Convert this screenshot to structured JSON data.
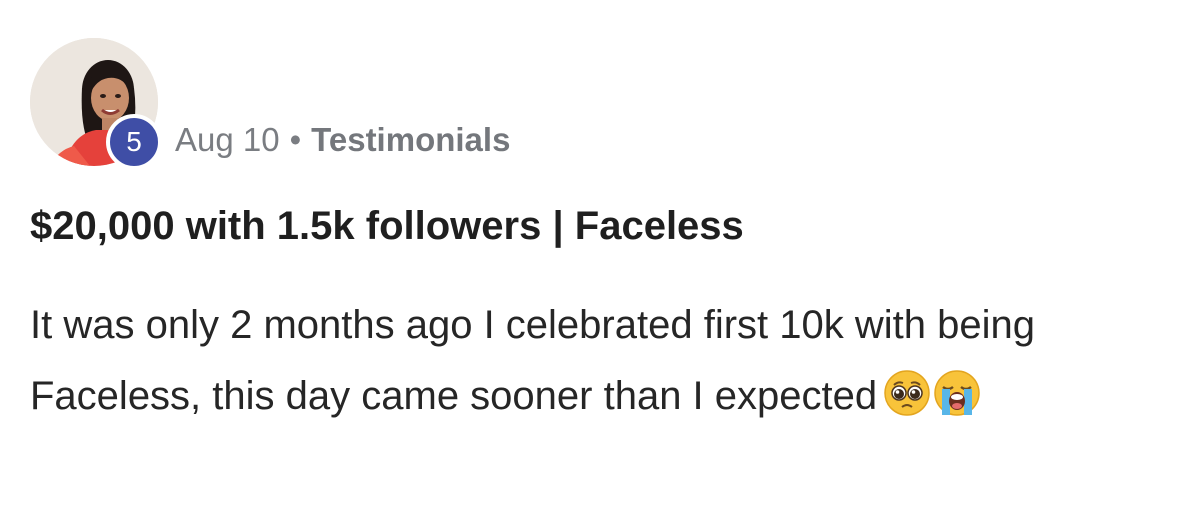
{
  "author": {
    "avatar_icon": "profile-photo",
    "level": "5",
    "badge_color": "#3f4ea6"
  },
  "post": {
    "date": "Aug 10",
    "separator": "•",
    "category": "Testimonials",
    "title": "$20,000 with 1.5k followers | Faceless",
    "body_text": "It was only 2 months ago I celebrated first 10k with being Faceless, this day came sooner than I expected",
    "emojis": [
      "pleading-face-emoji",
      "loudly-crying-face-emoji"
    ]
  }
}
